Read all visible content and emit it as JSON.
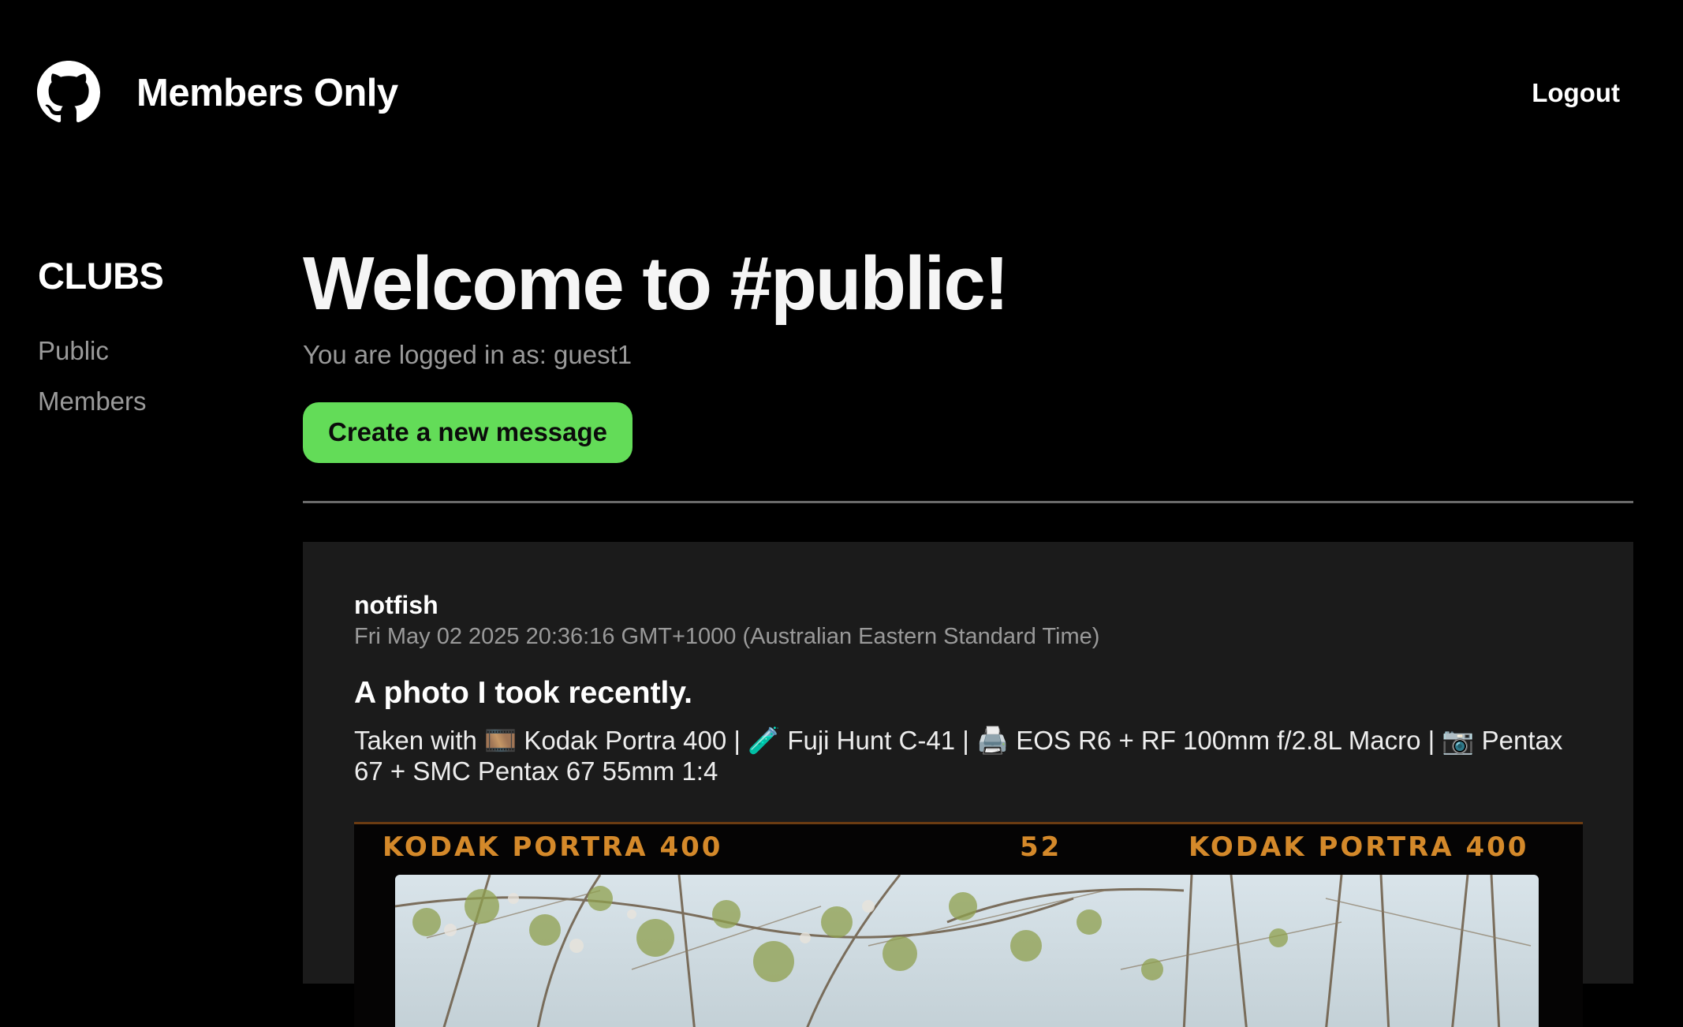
{
  "header": {
    "logo_icon": "github-icon",
    "brand": "Members Only",
    "logout_label": "Logout"
  },
  "sidebar": {
    "title": "CLUBS",
    "items": [
      {
        "label": "Public"
      },
      {
        "label": "Members"
      }
    ]
  },
  "main": {
    "title": "Welcome to #public!",
    "logged_in_text": "You are logged in as: guest1",
    "create_button_label": "Create a new message"
  },
  "messages": [
    {
      "author": "notfish",
      "date": "Fri May 02 2025 20:36:16 GMT+1000 (Australian Eastern Standard Time)",
      "title": "A photo I took recently.",
      "body": "Taken with 🎞️ Kodak Portra 400 | 🧪 Fuji Hunt C-41 | 🖨️ EOS R6 + RF 100mm f/2.8L Macro | 📷 Pentax 67 + SMC Pentax 67 55mm 1:4",
      "image": {
        "film_edge_left": "KODAK  PORTRA 400",
        "frame_number": "52",
        "film_edge_right": "KODAK  PORTRA 400"
      }
    }
  ],
  "colors": {
    "background": "#000000",
    "accent_button": "#63dc58",
    "card_background": "#1b1b1b",
    "muted_text": "#9a9a9a",
    "film_text": "#d4892a"
  }
}
